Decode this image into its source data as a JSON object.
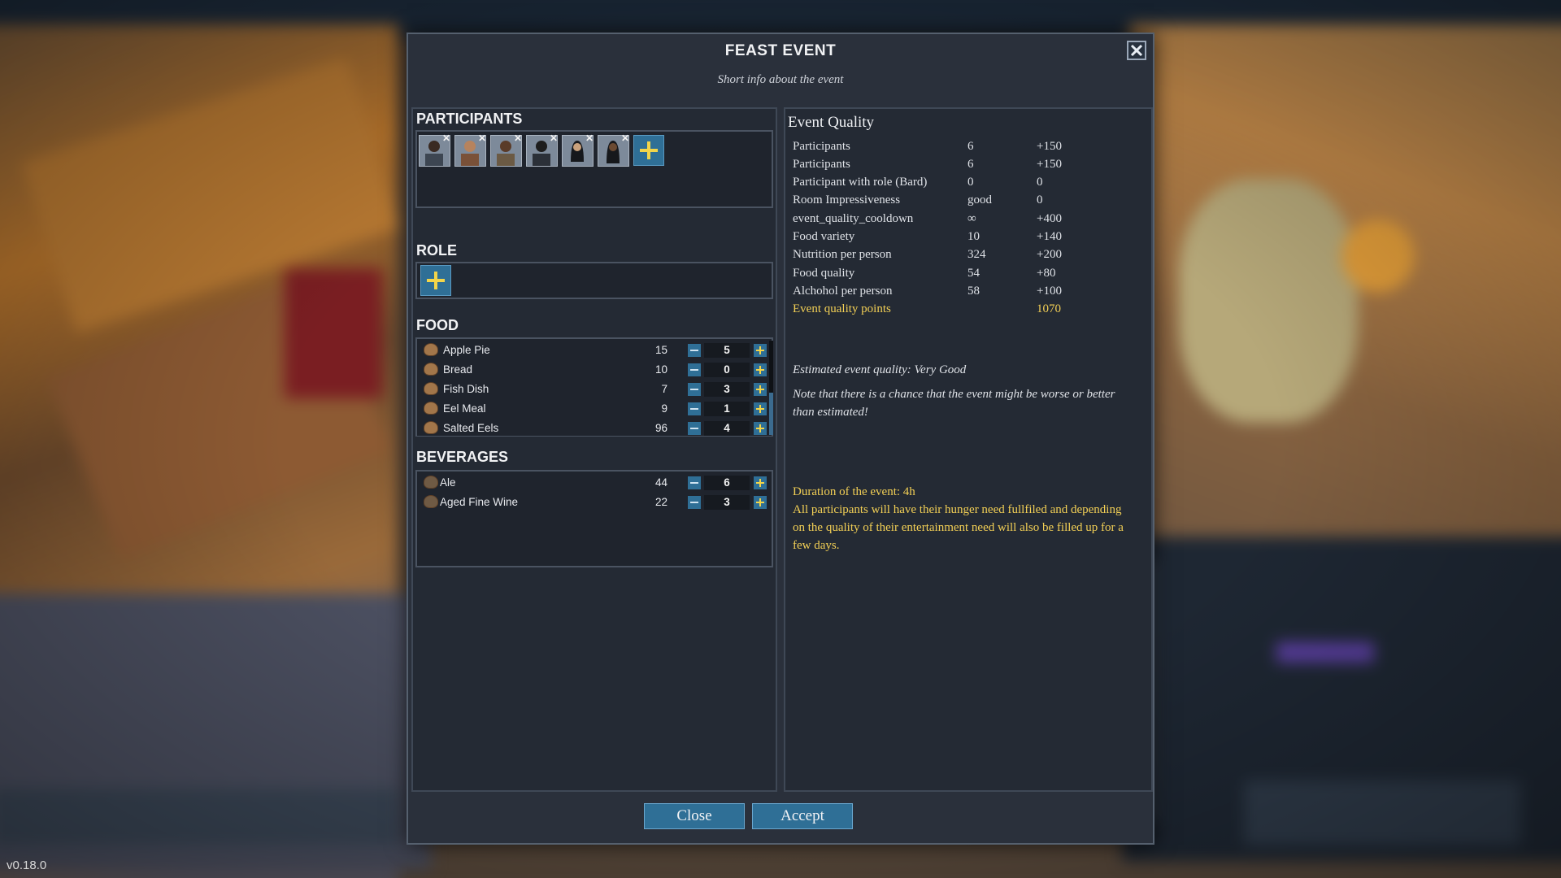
{
  "version": "v0.18.0",
  "dialog": {
    "title": "FEAST EVENT",
    "subtitle": "Short info about the event",
    "close_icon": "close-x-icon"
  },
  "participants": {
    "heading": "PARTICIPANTS",
    "count_shown": 6,
    "add_icon": "plus-icon"
  },
  "role": {
    "heading": "ROLE",
    "add_icon": "plus-icon"
  },
  "food": {
    "heading": "FOOD",
    "items": [
      {
        "name": "Apple Pie",
        "available": "15",
        "amount": "5"
      },
      {
        "name": "Bread",
        "available": "10",
        "amount": "0"
      },
      {
        "name": "Fish Dish",
        "available": "7",
        "amount": "3"
      },
      {
        "name": "Eel Meal",
        "available": "9",
        "amount": "1"
      },
      {
        "name": "Salted Eels",
        "available": "96",
        "amount": "4"
      }
    ]
  },
  "beverages": {
    "heading": "BEVERAGES",
    "items": [
      {
        "name": "Ale",
        "available": "44",
        "amount": "6"
      },
      {
        "name": "Aged Fine Wine",
        "available": "22",
        "amount": "3"
      }
    ]
  },
  "quality": {
    "heading": "Event Quality",
    "rows": [
      {
        "label": "Participants",
        "value": "6",
        "points": "+150"
      },
      {
        "label": "Participants",
        "value": "6",
        "points": "+150"
      },
      {
        "label": "Participant with role (Bard)",
        "value": "0",
        "points": "0"
      },
      {
        "label": "Room Impressiveness",
        "value": "good",
        "points": "0"
      },
      {
        "label": "event_quality_cooldown",
        "value": "∞",
        "points": "+400"
      },
      {
        "label": "Food variety",
        "value": "10",
        "points": "+140"
      },
      {
        "label": "Nutrition per person",
        "value": "324",
        "points": "+200"
      },
      {
        "label": "Food quality",
        "value": "54",
        "points": "+80"
      },
      {
        "label": "Alchohol per person",
        "value": "58",
        "points": "+100"
      }
    ],
    "total_label": "Event quality points",
    "total_points": "1070",
    "estimate": "Estimated event quality: Very Good",
    "warning": "Note that there is a chance that the event might be worse or better than estimated!",
    "duration": "Duration of the event: 4h",
    "effect": "All participants will have their hunger need fullfiled and depending on the quality of their entertainment need will also be filled up for a few days."
  },
  "buttons": {
    "close": "Close",
    "accept": "Accept"
  },
  "colors": {
    "accent_blue": "#2f6f96",
    "highlight_yellow": "#f2cf55",
    "panel": "#242a34"
  }
}
